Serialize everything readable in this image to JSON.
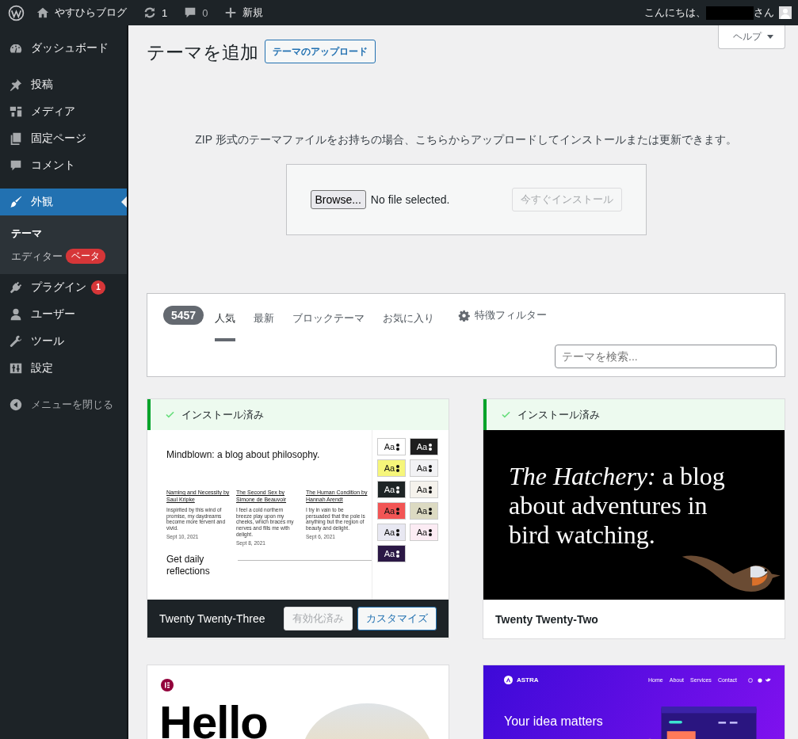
{
  "admin_bar": {
    "site_name": "やすひらブログ",
    "updates_count": "1",
    "comments_count": "0",
    "new_label": "新規",
    "greeting": "こんにちは、",
    "greeting_suffix": "さん"
  },
  "menu": [
    {
      "items": [
        {
          "label": "ダッシュボード",
          "kind": "dashboard",
          "selected": false
        }
      ]
    },
    {
      "items": [
        {
          "label": "投稿",
          "kind": "pin",
          "selected": false
        },
        {
          "label": "メディア",
          "kind": "media",
          "selected": false
        },
        {
          "label": "固定ページ",
          "kind": "pages",
          "selected": false
        },
        {
          "label": "コメント",
          "kind": "comment",
          "selected": false
        }
      ]
    },
    {
      "items": [
        {
          "label": "外観",
          "kind": "brush",
          "selected": true,
          "children": [
            {
              "label": "テーマ",
              "selected": true
            },
            {
              "label": "エディター",
              "badge": "ベータ",
              "selected": false
            }
          ]
        },
        {
          "label": "プラグイン",
          "kind": "plugin",
          "badge": "1",
          "selected": false
        },
        {
          "label": "ユーザー",
          "kind": "user",
          "selected": false
        },
        {
          "label": "ツール",
          "kind": "wrench",
          "selected": false
        },
        {
          "label": "設定",
          "kind": "settings",
          "selected": false
        }
      ]
    }
  ],
  "collapse_label": "メニューを閉じる",
  "help_button": "ヘルプ",
  "page": {
    "title": "テーマを追加",
    "upload_button": "テーマのアップロード"
  },
  "upload": {
    "description": "ZIP 形式のテーマファイルをお持ちの場合、こちらからアップロードしてインストールまたは更新できます。",
    "browse_button": "Browse...",
    "file_status": "No file selected.",
    "install_button": "今すぐインストール",
    "install_disabled": true
  },
  "filter_bar": {
    "count": "5457",
    "tabs": [
      {
        "label": "人気",
        "selected": true
      },
      {
        "label": "最新",
        "selected": false
      },
      {
        "label": "ブロックテーマ",
        "selected": false
      },
      {
        "label": "お気に入り",
        "selected": false
      }
    ],
    "feature_filter": "特徴フィルター",
    "search": {
      "placeholder": "テーマを検索..."
    }
  },
  "themes": [
    {
      "kind": "twenty-twenty-three",
      "installed": true,
      "installed_label": "インストール済み",
      "name": "Twenty Twenty-Three",
      "active": true,
      "actions": [
        {
          "label": "有効化済み",
          "disabled": true
        },
        {
          "label": "カスタマイズ",
          "disabled": false
        }
      ],
      "preview": {
        "headline": "Mindblown: a blog about philosophy.",
        "posts": [
          {
            "title": "Naming and Necessity by Saul Kripke",
            "excerpt": "Inspirited by this wind of promise, my daydreams become more fervent and vivid.",
            "date": "Sept 10, 2021"
          },
          {
            "title": "The Second Sex by Simone de Beauvoir",
            "excerpt": "I feel a cold northern breeze play upon my cheeks, which braces my nerves and fills me with delight.",
            "date": "Sept 8, 2021"
          },
          {
            "title": "The Human Condition by Hannah Arendt",
            "excerpt": "I try in vain to be persuaded that the pole is anything but the region of beauty and delight.",
            "date": "Sept 6, 2021"
          }
        ],
        "signup": "Get daily reflections",
        "swatches": [
          {
            "label": "Aa",
            "color": "#ffffff"
          },
          {
            "label": "Aa",
            "color": "#1e1e1e"
          },
          {
            "label": "Aa",
            "color": "#f6f67a"
          },
          {
            "label": "Aa",
            "color": "#f2f2f4"
          },
          {
            "label": "Aa",
            "color": "#1e2526"
          },
          {
            "label": "Aa",
            "color": "#f5f2ec"
          },
          {
            "label": "Aa",
            "color": "#f25555"
          },
          {
            "label": "Aa",
            "color": "#dcdac2"
          },
          {
            "label": "Aa",
            "color": "#e8e8f2"
          },
          {
            "label": "Aa",
            "color": "#fcecf4"
          },
          {
            "label": "Aa",
            "color": "#2b1845"
          }
        ]
      }
    },
    {
      "kind": "twenty-twenty-two",
      "installed": true,
      "installed_label": "インストール済み",
      "name": "Twenty Twenty-Two",
      "active": false,
      "preview": {
        "headline": "*The Hatchery:* a blog about adventures in bird watching."
      }
    },
    {
      "kind": "hello-elementor",
      "preview": {
        "headline": "Hello"
      }
    },
    {
      "kind": "astra",
      "preview": {
        "brand": "ASTRA",
        "nav": [
          "Home",
          "About",
          "Services",
          "Contact"
        ],
        "headline": "Your idea matters"
      }
    }
  ]
}
